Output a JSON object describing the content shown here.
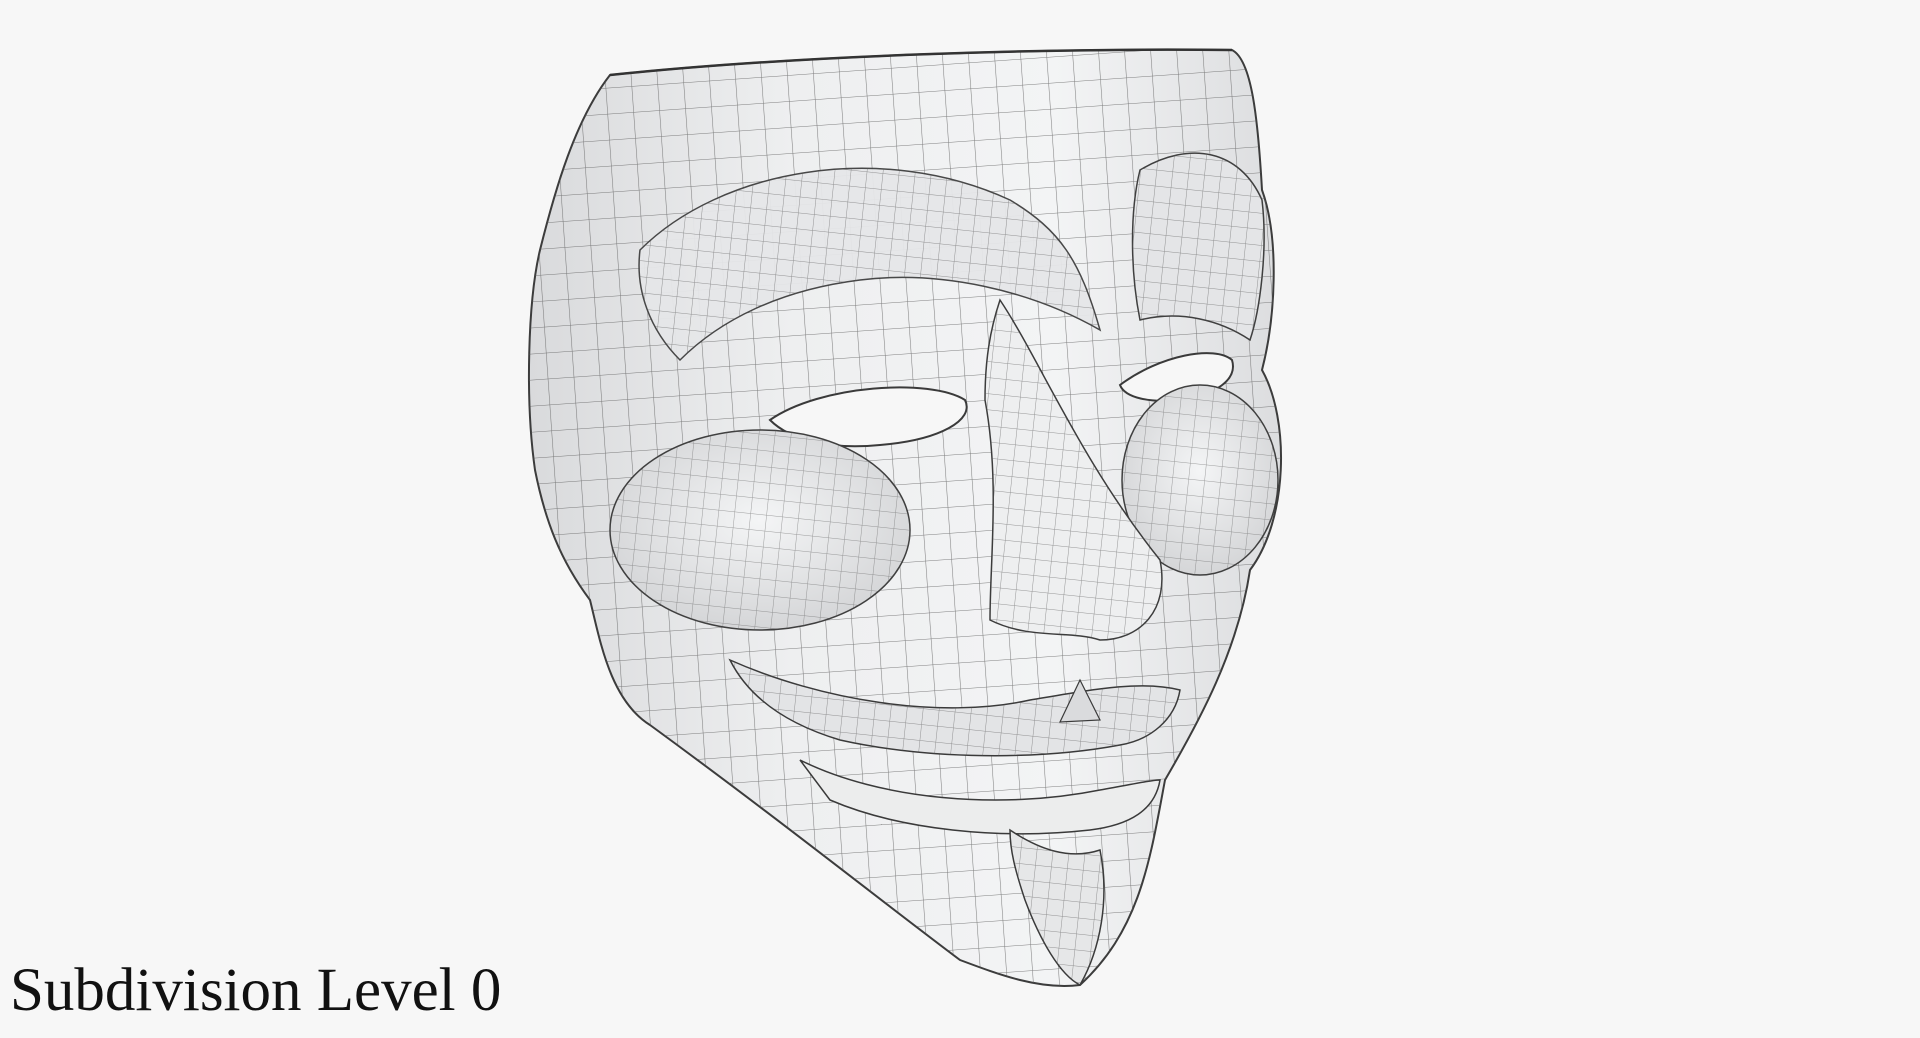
{
  "caption": "Subdivision Level 0",
  "colors": {
    "background": "#f7f7f7",
    "mask_fill": "#e9eaeb",
    "wire": "#4a4a4a",
    "caption_text": "#111111"
  },
  "scene": {
    "subject": "theater-mask-wireframe",
    "shading": "clay-with-wireframe-overlay"
  }
}
